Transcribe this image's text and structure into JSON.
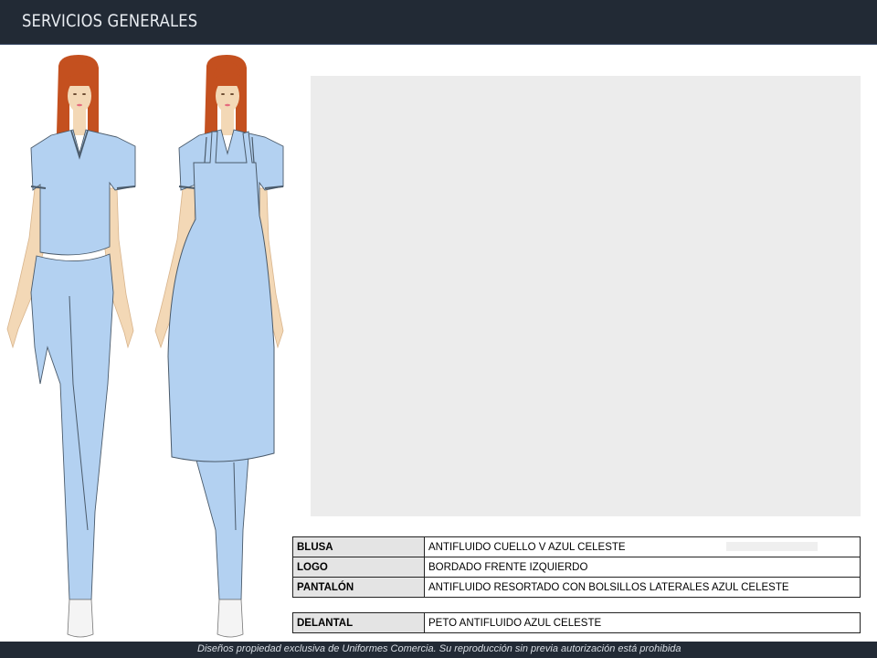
{
  "header": {
    "title": "SERVICIOS GENERALES"
  },
  "spec_rows": [
    {
      "label": "BLUSA",
      "value": "ANTIFLUIDO CUELLO V AZUL CELESTE"
    },
    {
      "label": "LOGO",
      "value": "BORDADO FRENTE IZQUIERDO"
    },
    {
      "label": "PANTALÓN",
      "value": "ANTIFLUIDO RESORTADO CON BOLSILLOS LATERALES AZUL CELESTE"
    }
  ],
  "apron_row": {
    "label": "DELANTAL",
    "value": "PETO ANTIFLUIDO AZUL CELESTE"
  },
  "footer": {
    "text": "Diseños propiedad exclusiva de Uniformes Comercia. Su reproducción sin previa autorización está prohibida"
  },
  "colors": {
    "header_bg": "#222a35",
    "garment": "#b3d1f1",
    "hair": "#c4501f",
    "skin": "#f3d8b6",
    "photo_placeholder": "#ececec"
  }
}
